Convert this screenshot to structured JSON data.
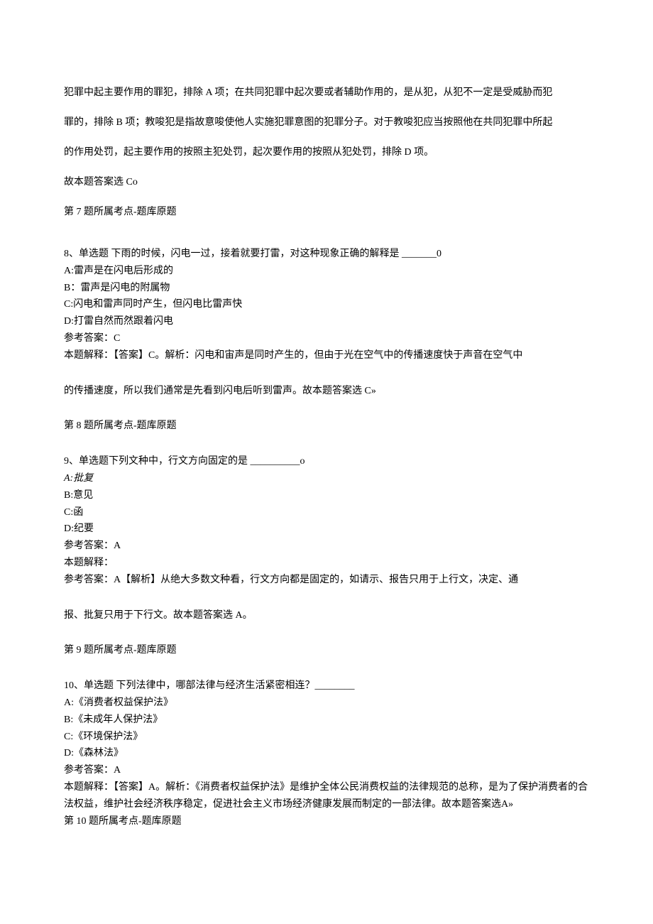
{
  "topSection": {
    "line1": "犯罪中起主要作用的罪犯，排除 A 项；在共同犯罪中起次要或者辅助作用的，是从犯，从犯不一定是受威胁而犯",
    "line2": "罪的，排除 B 项；教唆犯是指故意唆使他人实施犯罪意图的犯罪分子。对于教唆犯应当按照他在共同犯罪中所起",
    "line3": "的作用处罚，起主要作用的按照主犯处罚，起次要作用的按照从犯处罚，排除 D 项。",
    "line4": "故本题答案选 Co",
    "line5": "第 7 题所属考点-题库原题"
  },
  "q8": {
    "stem": "8、单选题      下雨的时候，闪电一过，接着就要打雷，对这种现象正确的解释是 _______0",
    "optA": "A:雷声是在闪电后形成的",
    "optB": "B：雷声是闪电的附属物",
    "optC": "C:闪电和雷声同时产生，但闪电比雷声快",
    "optD": "D:打雷自然而然跟着闪电",
    "ans": "参考答案：C",
    "expl1": "本题解释：【答案】C。解析：闪电和宙声是同时产生的，但由于光在空气中的传播速度快于声音在空气中",
    "expl2": "的传播速度，所以我们通常是先看到闪电后听到雷声。故本题答案选 C»",
    "foot": "第 8 题所属考点-题库原题"
  },
  "q9": {
    "stem": "9、单选题下列文种中，行文方向固定的是 __________o",
    "optA": "A:批复",
    "optB": "B:意见",
    "optC": "C:函",
    "optD": "D:纪要",
    "ans": "参考答案：A",
    "expl0": "本题解释：",
    "expl1": "参考答案：A【解析】从绝大多数文种看，行文方向都是固定的，如请示、报告只用于上行文，决定、通",
    "expl2": "报、批复只用于下行文。故本题答案选 A。",
    "foot": "第 9 题所属考点-题库原题"
  },
  "q10": {
    "stem": "10、单选题    下列法律中，哪部法律与经济生活紧密相连？________",
    "optA": "A:《消费者权益保护法》",
    "optB": "B:《未成年人保护法》",
    "optC": "C:《环境保护法》",
    "optD": "D:《森林法》",
    "ans": "参考答案：A",
    "expl1": "本题解释：【答案】A。解析：《消费者权益保护法》是维护全体公民消费权益的法律规范的总称，是为了保护消费者的合法权益，维护社会经济秩序稳定，促进社会主义市场经济健康发展而制定的一部法律。故本题答案选A»",
    "foot": "第 10 题所属考点-题库原题"
  }
}
